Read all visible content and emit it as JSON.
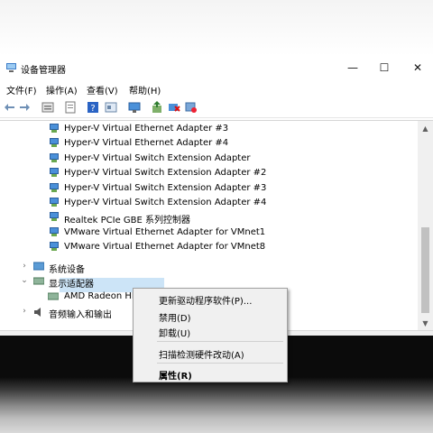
{
  "window": {
    "title": "设备管理器",
    "controls": {
      "minimize": "—",
      "maximize": "☐",
      "close": "✕"
    }
  },
  "menubar": [
    "文件(F)",
    "操作(A)",
    "查看(V)",
    "帮助(H)"
  ],
  "toolbar_icons": [
    "back-arrow-icon",
    "forward-arrow-icon",
    "device-list-icon",
    "properties-sheet-icon",
    "help-icon",
    "view-icon",
    "monitor-icon",
    "update-driver-icon",
    "uninstall-device-icon",
    "scan-hardware-icon"
  ],
  "tree": {
    "adapter_items": [
      "Hyper-V Virtual Ethernet Adapter #3",
      "Hyper-V Virtual Ethernet Adapter #4",
      "Hyper-V Virtual Switch Extension Adapter",
      "Hyper-V Virtual Switch Extension Adapter #2",
      "Hyper-V Virtual Switch Extension Adapter #3",
      "Hyper-V Virtual Switch Extension Adapter #4",
      "Realtek PCIe GBE 系列控制器",
      "VMware Virtual Ethernet Adapter for VMnet1",
      "VMware Virtual Ethernet Adapter for VMnet8"
    ],
    "system_devices": "系统设备",
    "display_adapters": "显示适配器",
    "selected_device": "AMD Radeon HD",
    "audio": "音频输入和输出"
  },
  "context_menu": {
    "update_driver": "更新驱动程序软件(P)...",
    "disable": "禁用(D)",
    "uninstall": "卸载(U)",
    "scan": "扫描检测硬件改动(A)",
    "properties": "属性(R)"
  },
  "colors": {
    "selection": "#cce4f7",
    "adapter_icon": "#4a90d9",
    "menu_bg": "#f0f0f0"
  }
}
